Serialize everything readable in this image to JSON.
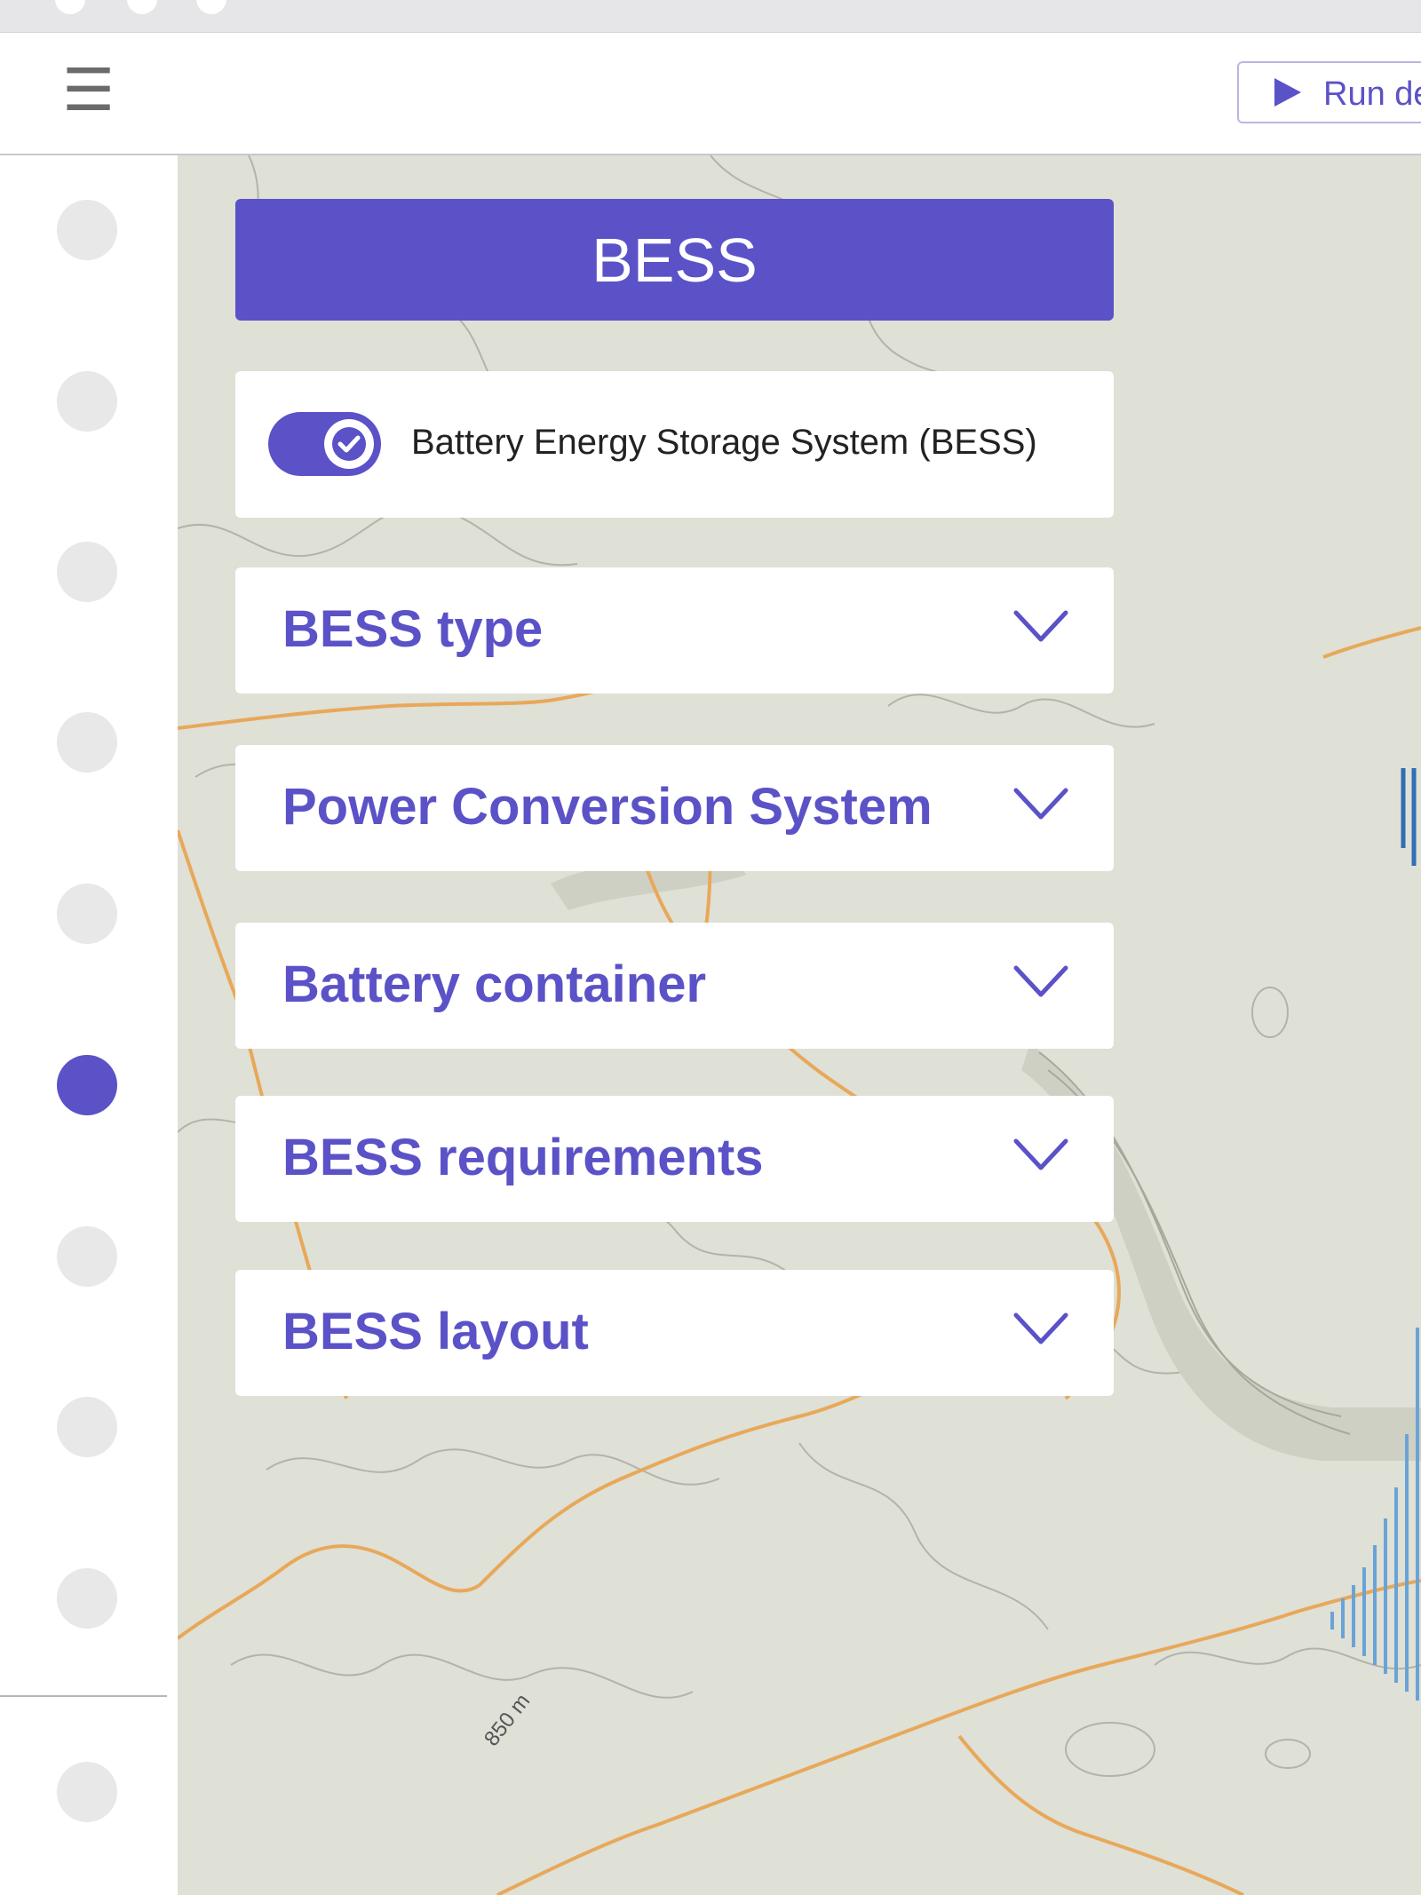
{
  "toolbar": {
    "menu_icon": "hamburger-icon",
    "run_button_label": "Run de",
    "run_icon": "play-icon"
  },
  "sidebar": {
    "steps_count": 10,
    "active_step": 6
  },
  "panel": {
    "title": "BESS",
    "toggle": {
      "label": "Battery Energy Storage System (BESS)",
      "checked": true
    },
    "sections": [
      {
        "label": "BESS type"
      },
      {
        "label": "Power Conversion System"
      },
      {
        "label": "Battery container"
      },
      {
        "label": "BESS requirements"
      },
      {
        "label": "BESS layout"
      }
    ]
  },
  "map": {
    "scale_label": "850 m"
  },
  "colors": {
    "accent": "#5b52c7",
    "map_background": "#dfe0d6",
    "road": "#e8a85a"
  }
}
